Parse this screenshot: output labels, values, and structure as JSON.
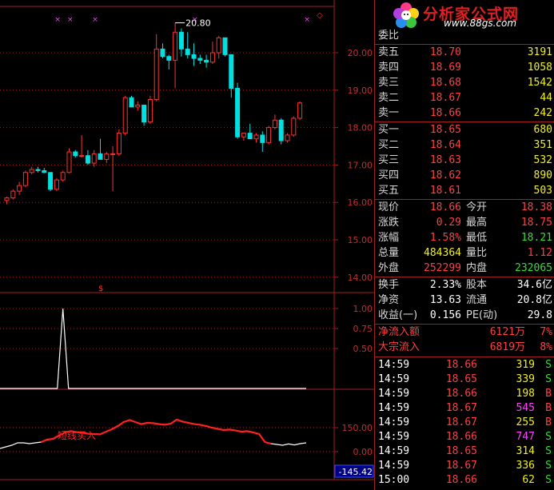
{
  "colors": {
    "up": "#ff3030",
    "down": "#00e0e0",
    "grid": "#a02020",
    "axis_text": "#c03030",
    "bg": "#000000"
  },
  "header": {
    "logo_title": "分析家公式网",
    "logo_url": "www.88gs.com",
    "wei_label": "委比"
  },
  "price_axis": {
    "labels": [
      "20.00",
      "19.00",
      "18.00",
      "17.00",
      "16.00",
      "15.00",
      "14.00"
    ]
  },
  "candles": [
    [
      16.05,
      16.15,
      15.95,
      16.12
    ],
    [
      16.12,
      16.35,
      16.08,
      16.3
    ],
    [
      16.3,
      16.55,
      16.2,
      16.45
    ],
    [
      16.45,
      16.85,
      16.4,
      16.8
    ],
    [
      16.8,
      16.95,
      16.75,
      16.88
    ],
    [
      16.88,
      16.95,
      16.8,
      16.85
    ],
    [
      16.85,
      16.92,
      16.78,
      16.8
    ],
    [
      16.8,
      16.75,
      16.3,
      16.35
    ],
    [
      16.35,
      16.65,
      16.3,
      16.6
    ],
    [
      16.6,
      16.85,
      16.55,
      16.8
    ],
    [
      16.8,
      17.45,
      16.78,
      17.35
    ],
    [
      17.35,
      17.4,
      17.2,
      17.25
    ],
    [
      17.25,
      17.8,
      17.2,
      17.25
    ],
    [
      17.25,
      17.4,
      17.0,
      17.05
    ],
    [
      17.05,
      17.4,
      16.95,
      17.3
    ],
    [
      17.3,
      17.7,
      17.2,
      17.15
    ],
    [
      17.15,
      17.35,
      17.05,
      17.3
    ],
    [
      17.3,
      17.5,
      16.3,
      17.3
    ],
    [
      17.3,
      17.95,
      17.25,
      17.85
    ],
    [
      17.85,
      18.85,
      17.8,
      18.8
    ],
    [
      18.8,
      18.85,
      18.55,
      18.55
    ],
    [
      18.55,
      18.7,
      18.45,
      18.6
    ],
    [
      18.6,
      18.55,
      18.05,
      18.15
    ],
    [
      18.15,
      18.85,
      18.1,
      18.75
    ],
    [
      18.75,
      20.5,
      18.7,
      20.1
    ],
    [
      20.1,
      20.25,
      19.85,
      19.9
    ],
    [
      19.9,
      19.95,
      19.55,
      19.8
    ],
    [
      19.8,
      20.8,
      19.05,
      20.55
    ],
    [
      20.55,
      20.65,
      19.9,
      20.1
    ],
    [
      20.1,
      20.55,
      19.85,
      19.95
    ],
    [
      19.95,
      20.25,
      19.65,
      19.85
    ],
    [
      19.85,
      19.95,
      19.7,
      19.8
    ],
    [
      19.8,
      19.95,
      19.6,
      19.75
    ],
    [
      19.75,
      20.3,
      19.7,
      20.0
    ],
    [
      20.0,
      20.45,
      19.85,
      20.4
    ],
    [
      20.4,
      20.35,
      19.9,
      19.95
    ],
    [
      19.95,
      19.5,
      18.8,
      19.05
    ],
    [
      19.05,
      19.2,
      17.7,
      17.75
    ],
    [
      17.75,
      17.85,
      17.65,
      17.85
    ],
    [
      17.85,
      18.1,
      17.8,
      17.7
    ],
    [
      17.7,
      17.85,
      17.6,
      17.8
    ],
    [
      17.8,
      17.9,
      17.35,
      17.6
    ],
    [
      17.6,
      18.05,
      17.55,
      18.0
    ],
    [
      18.0,
      18.35,
      17.95,
      18.2
    ],
    [
      18.2,
      18.25,
      17.55,
      17.65
    ],
    [
      17.65,
      17.85,
      17.6,
      17.8
    ],
    [
      17.8,
      18.3,
      17.75,
      18.25
    ],
    [
      18.25,
      18.7,
      18.2,
      18.66
    ]
  ],
  "high_label": "20.80",
  "markers": {
    "x_marks_at": [
      8,
      10,
      14,
      30,
      48
    ],
    "s_mark_at": 15,
    "top_right_glyph": "◇"
  },
  "indicator1": {
    "labels": [
      "1.00",
      "0.75",
      "0.50"
    ],
    "spike_at": 9
  },
  "indicator2": {
    "labels": [
      "150.00",
      "0.00"
    ],
    "readout": "-145.42",
    "annotation": "短线买入",
    "values": [
      20,
      30,
      40,
      55,
      55,
      50,
      55,
      60,
      75,
      80,
      100,
      120,
      128,
      122,
      118,
      112,
      110,
      108,
      125,
      140,
      160,
      185,
      198,
      185,
      172,
      180,
      178,
      172,
      168,
      175,
      200,
      188,
      180,
      172,
      168,
      160,
      150,
      142,
      135,
      138,
      132,
      125,
      128,
      120,
      110,
      60,
      50,
      45,
      40,
      48,
      42,
      50,
      55
    ]
  },
  "orderbook": {
    "sell": [
      {
        "label": "卖五",
        "price": "18.70",
        "vol": "3191"
      },
      {
        "label": "卖四",
        "price": "18.69",
        "vol": "1058"
      },
      {
        "label": "卖三",
        "price": "18.68",
        "vol": "1542"
      },
      {
        "label": "卖二",
        "price": "18.67",
        "vol": "44"
      },
      {
        "label": "卖一",
        "price": "18.66",
        "vol": "242"
      }
    ],
    "buy": [
      {
        "label": "买一",
        "price": "18.65",
        "vol": "680"
      },
      {
        "label": "买二",
        "price": "18.64",
        "vol": "351"
      },
      {
        "label": "买三",
        "price": "18.63",
        "vol": "532"
      },
      {
        "label": "买四",
        "price": "18.62",
        "vol": "890"
      },
      {
        "label": "买五",
        "price": "18.61",
        "vol": "503"
      }
    ]
  },
  "stats": {
    "xianjia_label": "现价",
    "xianjia": "18.66",
    "jinkai_label": "今开",
    "jinkai": "18.38",
    "zhangdie_label": "涨跌",
    "zhangdie": "0.29",
    "zuigao_label": "最高",
    "zuigao": "18.75",
    "zhangfu_label": "涨幅",
    "zhangfu": "1.58%",
    "zuidi_label": "最低",
    "zuidi": "18.21",
    "zongliang_label": "总量",
    "zongliang": "484364",
    "liangbi_label": "量比",
    "liangbi": "1.12",
    "waipan_label": "外盘",
    "waipan": "252299",
    "neipan_label": "内盘",
    "neipan": "232065",
    "huanshou_label": "换手",
    "huanshou": "2.33%",
    "guben_label": "股本",
    "guben": "34.6亿",
    "jingzi_label": "净资",
    "jingzi": "13.63",
    "liutong_label": "流通",
    "liutong": "20.8亿",
    "shouyi_label": "收益(一)",
    "shouyi": "0.156",
    "pe_label": "PE(动)",
    "pe": "29.8",
    "jingliuru_label": "净流入额",
    "jingliuru": "6121万",
    "jingliuru_pct": "7%",
    "dazong_label": "大宗流入",
    "dazong": "6819万",
    "dazong_pct": "8%"
  },
  "ticks": [
    {
      "time": "14:59",
      "price": "18.66",
      "vol": "319",
      "side": "S",
      "pc": "red",
      "vc": "yellow"
    },
    {
      "time": "14:59",
      "price": "18.65",
      "vol": "339",
      "side": "S",
      "pc": "red",
      "vc": "yellow"
    },
    {
      "time": "14:59",
      "price": "18.66",
      "vol": "198",
      "side": "B",
      "pc": "red",
      "vc": "yellow"
    },
    {
      "time": "14:59",
      "price": "18.67",
      "vol": "545",
      "side": "B",
      "pc": "red",
      "vc": "magenta"
    },
    {
      "time": "14:59",
      "price": "18.67",
      "vol": "255",
      "side": "B",
      "pc": "red",
      "vc": "yellow"
    },
    {
      "time": "14:59",
      "price": "18.66",
      "vol": "747",
      "side": "S",
      "pc": "red",
      "vc": "magenta"
    },
    {
      "time": "14:59",
      "price": "18.65",
      "vol": "314",
      "side": "S",
      "pc": "red",
      "vc": "yellow"
    },
    {
      "time": "14:59",
      "price": "18.67",
      "vol": "336",
      "side": "S",
      "pc": "red",
      "vc": "yellow"
    },
    {
      "time": "15:00",
      "price": "18.66",
      "vol": "62",
      "side": "S",
      "pc": "red",
      "vc": "yellow"
    }
  ]
}
